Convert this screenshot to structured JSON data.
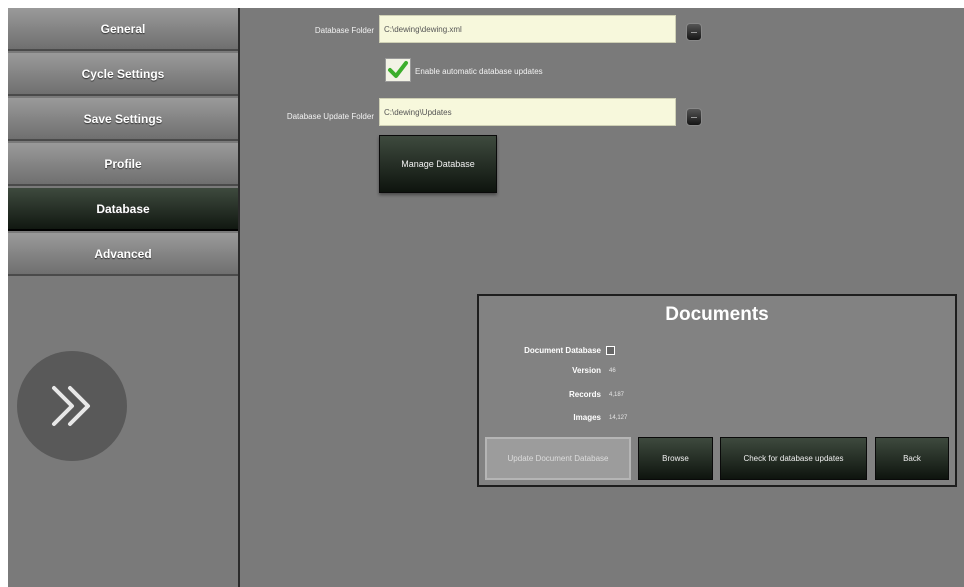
{
  "sidebar": {
    "items": [
      {
        "label": "General"
      },
      {
        "label": "Cycle Settings"
      },
      {
        "label": "Save Settings"
      },
      {
        "label": "Profile"
      },
      {
        "label": "Database"
      },
      {
        "label": "Advanced"
      }
    ],
    "active_item": "Database",
    "expand_icon": "double-chevron-right-icon"
  },
  "settings": {
    "database_folder_label": "Database Folder",
    "database_folder_value": "C:\\dewing\\dewing.xml",
    "auto_update_label": "Enable automatic database updates",
    "auto_update_checked": true,
    "update_folder_label": "Database Update Folder",
    "update_folder_value": "C:\\dewing\\Updates",
    "manage_button": "Manage Database"
  },
  "documents": {
    "title": "Documents",
    "db_label": "Document Database",
    "version_label": "Version",
    "version_value": "46",
    "records_label": "Records",
    "records_value": "4,187",
    "images_label": "Images",
    "images_value": "14,127",
    "buttons": {
      "update": "Update Document Database",
      "browse": "Browse",
      "check": "Check for database updates",
      "back": "Back"
    }
  },
  "colors": {
    "accent_green": "#3cae2c",
    "field_bg": "#f7f8dc",
    "panel_gray": "#7a7a7a"
  }
}
